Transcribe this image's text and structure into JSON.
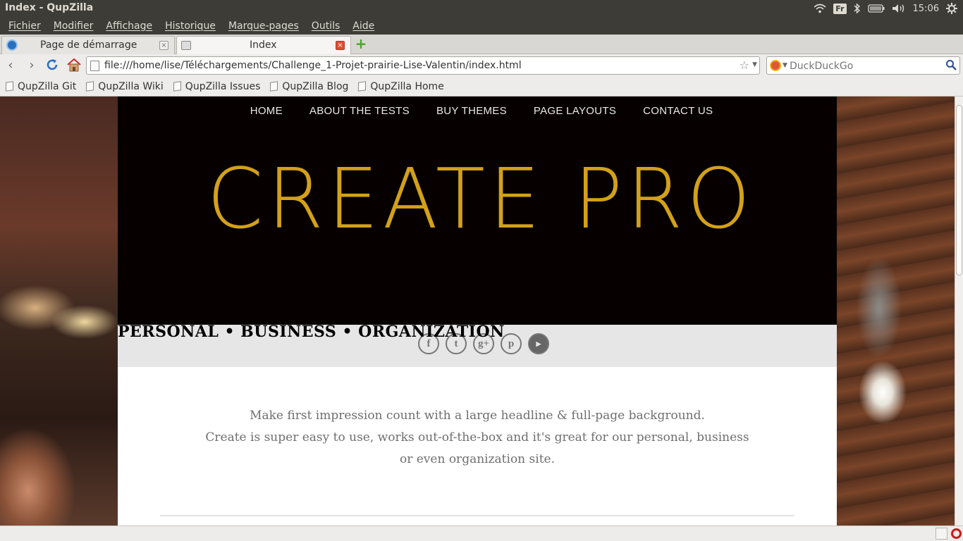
{
  "window": {
    "title": "Index - QupZilla"
  },
  "system_tray": {
    "lang": "Fr",
    "time": "15:06",
    "icons": [
      "wifi-icon",
      "bluetooth-icon",
      "battery-icon",
      "volume-icon",
      "gear-icon"
    ]
  },
  "menubar": {
    "items": [
      "Fichier",
      "Modifier",
      "Affichage",
      "Historique",
      "Marque-pages",
      "Outils",
      "Aide"
    ]
  },
  "tabs": [
    {
      "label": "Page de démarrage",
      "active": false
    },
    {
      "label": "Index",
      "active": true
    }
  ],
  "toolbar": {
    "url": "file:///home/lise/Téléchargements/Challenge_1-Projet-prairie-Lise-Valentin/index.html",
    "search_placeholder": "DuckDuckGo"
  },
  "bookmarks": [
    "QupZilla Git",
    "QupZilla Wiki",
    "QupZilla Issues",
    "QupZilla Blog",
    "QupZilla Home"
  ],
  "site": {
    "nav": [
      "HOME",
      "ABOUT THE TESTS",
      "BUY THEMES",
      "PAGE LAYOUTS",
      "CONTACT US"
    ],
    "logo": "CREATE PRO",
    "tagline": "PERSONAL • BUSINESS • ORGANIZATION",
    "social": [
      {
        "name": "facebook-icon",
        "glyph": "f"
      },
      {
        "name": "twitter-icon",
        "glyph": "t"
      },
      {
        "name": "google-plus-icon",
        "glyph": "g+"
      },
      {
        "name": "pinterest-icon",
        "glyph": "p"
      },
      {
        "name": "youtube-icon",
        "glyph": "You\nTube"
      }
    ],
    "intro": [
      "Make first impression count with a large headline & full-page background.",
      "Create is super easy to use, works out-of-the-box and it's great for our personal, business",
      "or even organization site."
    ],
    "colors": {
      "logo": "#d3a118",
      "hero_bg": "#060100",
      "band_bg": "#e6e6e6"
    }
  }
}
